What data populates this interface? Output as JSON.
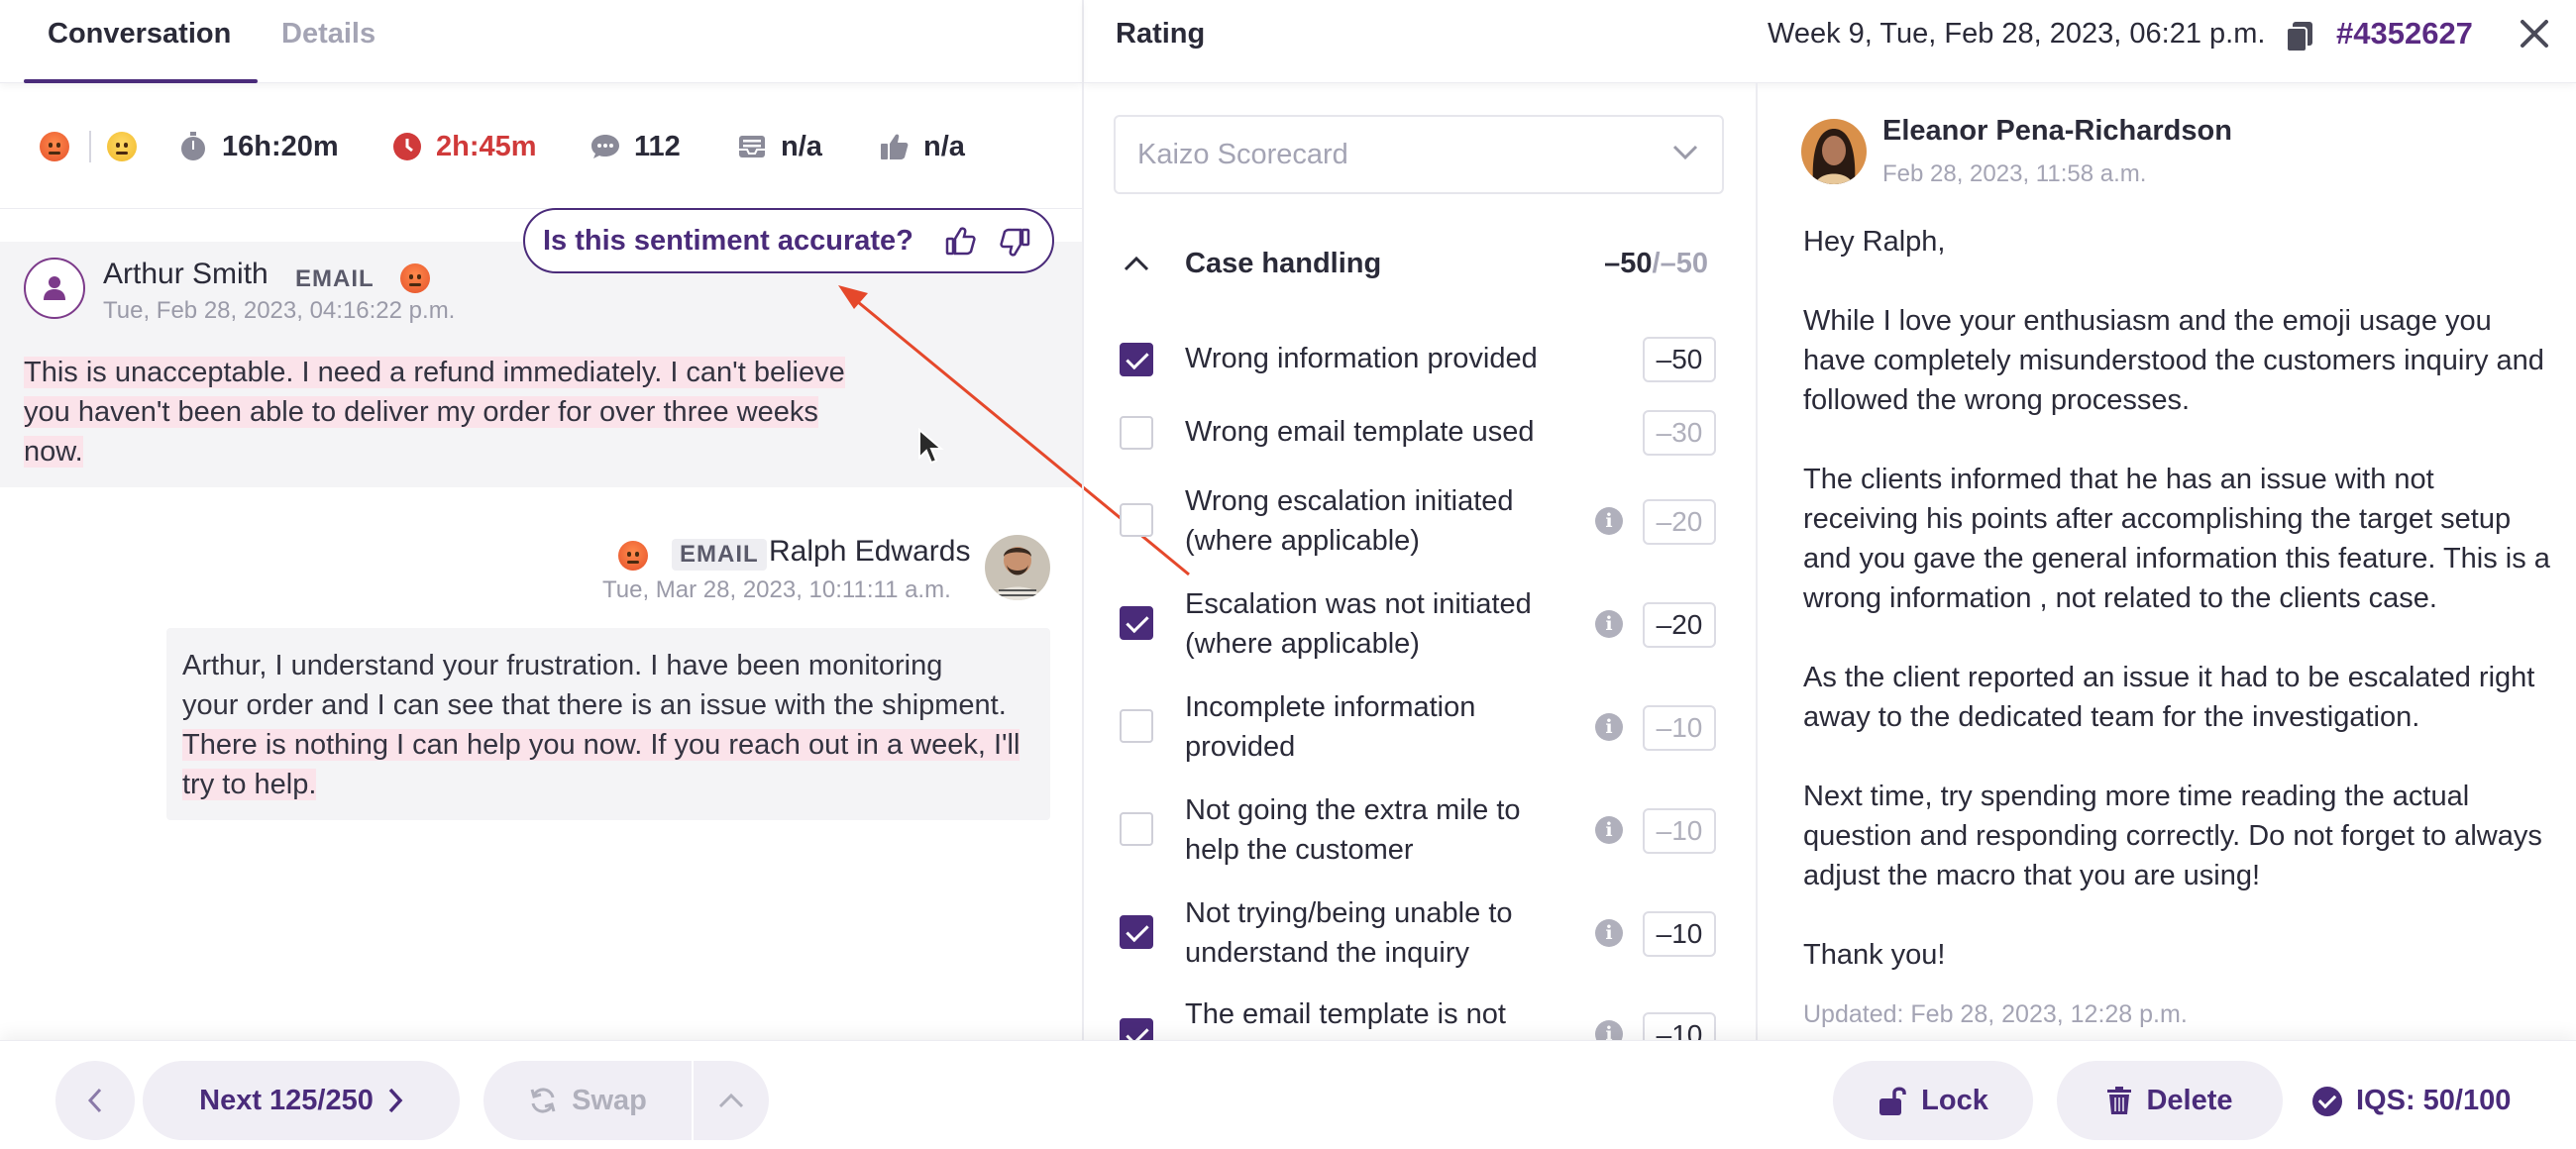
{
  "tabs": {
    "conversation": "Conversation",
    "details": "Details"
  },
  "stats": {
    "duration": "16h:20m",
    "response_time": "2h:45m",
    "messages": "112",
    "csat": "n/a",
    "rating": "n/a"
  },
  "sentiment_prompt": "Is this sentiment accurate?",
  "message1": {
    "author": "Arthur Smith",
    "channel": "EMAIL",
    "time": "Tue, Feb 28, 2023, 04:16:22 p.m.",
    "body_line1": "This is unacceptable. I need a refund immediately. I can't believe",
    "body_line2": "you haven't been able to deliver my order for over three weeks",
    "body_line3": "now."
  },
  "message2": {
    "author": "Ralph Edwards",
    "channel": "EMAIL",
    "time": "Tue, Mar 28, 2023, 10:11:11 a.m.",
    "body_line1": "Arthur, I understand your frustration. I have been monitoring",
    "body_line2": "your order and I can see that there is an issue with the shipment.",
    "body_line3": "There is nothing I can help you now. If you reach out in a week, I'll",
    "body_line4": "try to help."
  },
  "rating": {
    "title": "Rating",
    "date": "Week 9, Tue, Feb 28, 2023, 06:21 p.m.",
    "ticket": "#4352627",
    "scorecard": "Kaizo Scorecard",
    "category": "Case handling",
    "category_score": "–50",
    "category_max": "/–50",
    "criteria": [
      {
        "label": "Wrong information provided",
        "score": "–50",
        "checked": true
      },
      {
        "label": "Wrong email template used",
        "score": "–30",
        "checked": false
      },
      {
        "label": "Wrong escalation initiated (where applicable)",
        "score": "–20",
        "checked": false
      },
      {
        "label": "Escalation was not initiated (where applicable)",
        "score": "–20",
        "checked": true
      },
      {
        "label": "Incomplete information provided",
        "score": "–10",
        "checked": false
      },
      {
        "label": "Not going the extra mile to help the customer",
        "score": "–10",
        "checked": false
      },
      {
        "label": "Not trying/being unable to understand the inquiry",
        "score": "–10",
        "checked": true
      },
      {
        "label": "The email template is not",
        "score": "–10",
        "checked": true
      }
    ]
  },
  "feedback": {
    "author": "Eleanor Pena-Richardson",
    "time": "Feb 28, 2023, 11:58 a.m.",
    "greeting": "Hey Ralph,",
    "p1": "While I love your enthusiasm and the emoji usage you have completely misunderstood the customers inquiry and followed the wrong processes.",
    "p2": "The clients informed that he has an issue with not receiving his points after accomplishing the target setup and you gave the general information this feature. This is a wrong information , not related to the clients case.",
    "p3": "As the client reported an issue it had to be escalated right away to the dedicated team for the investigation.",
    "p4": "Next time, try spending more time reading the actual question and responding correctly. Do not forget to always adjust the macro that you are using!",
    "signoff": "Thank you!",
    "updated": "Updated: Feb 28, 2023, 12:28 p.m."
  },
  "footer": {
    "next": "Next 125/250",
    "swap": "Swap",
    "lock": "Lock",
    "delete": "Delete",
    "iqs": "IQS: 50/100"
  },
  "colors": {
    "brand": "#4a2b7a",
    "accent_red": "#d03a3a",
    "arrow": "#e5482b",
    "highlight": "#fbe3ea"
  }
}
